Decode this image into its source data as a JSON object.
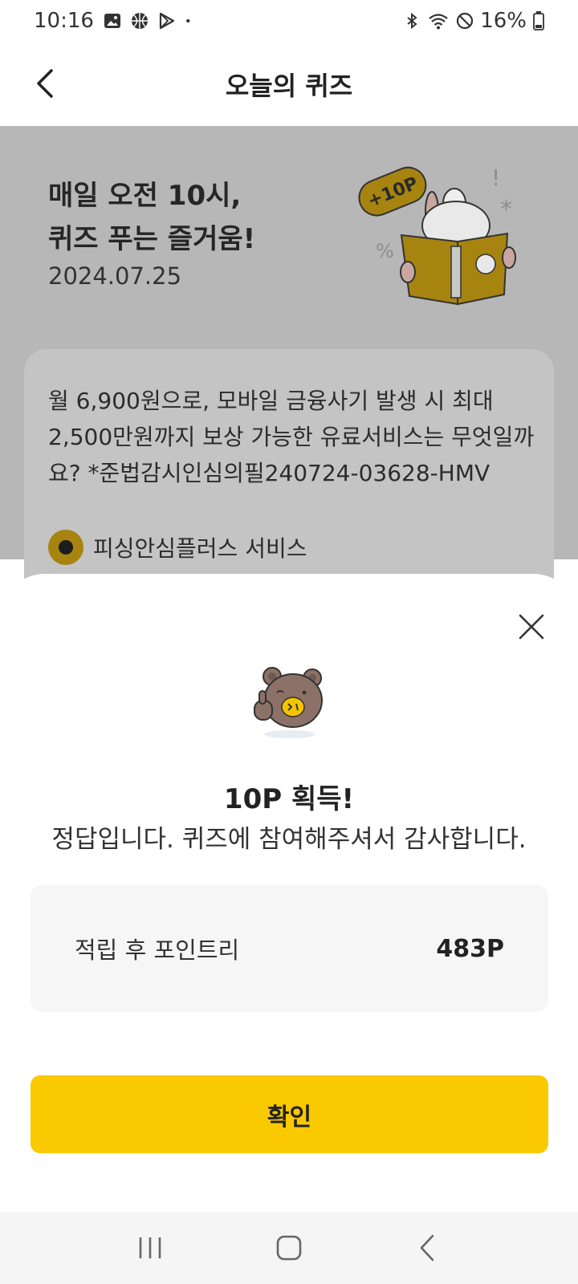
{
  "status_bar": {
    "time": "10:16",
    "battery": "16%",
    "icons": [
      "image-icon",
      "basketball-icon",
      "play-store-icon",
      "dot-icon",
      "bluetooth-icon",
      "wifi-icon",
      "dnd-icon",
      "battery-icon"
    ]
  },
  "header": {
    "title": "오늘의 퀴즈",
    "back_icon": "back-arrow-icon"
  },
  "banner": {
    "title_line1": "매일 오전 10시,",
    "title_line2": "퀴즈 푸는 즐거움!",
    "date": "2024.07.25",
    "badge": "+10P"
  },
  "quiz": {
    "question": "월 6,900원으로, 모바일 금융사기 발생 시 최대 2,500만원까지 보상 가능한 유료서비스는 무엇일까요? *준법감시인심의필240724-03628-HMV",
    "selected_option": "피싱안심플러스 서비스"
  },
  "sheet": {
    "reward_title": "10P 획득!",
    "reward_message": "정답입니다. 퀴즈에 참여해주셔서 감사합니다.",
    "points_label": "적립 후 포인트리",
    "points_value": "483P",
    "confirm_label": "확인"
  },
  "colors": {
    "accent": "#fbc900",
    "dim_overlay": "#b7b7b7",
    "points_box_bg": "#f6f6f6"
  },
  "nav_bar": {
    "icons": [
      "recent-apps-icon",
      "home-icon",
      "back-icon"
    ]
  }
}
